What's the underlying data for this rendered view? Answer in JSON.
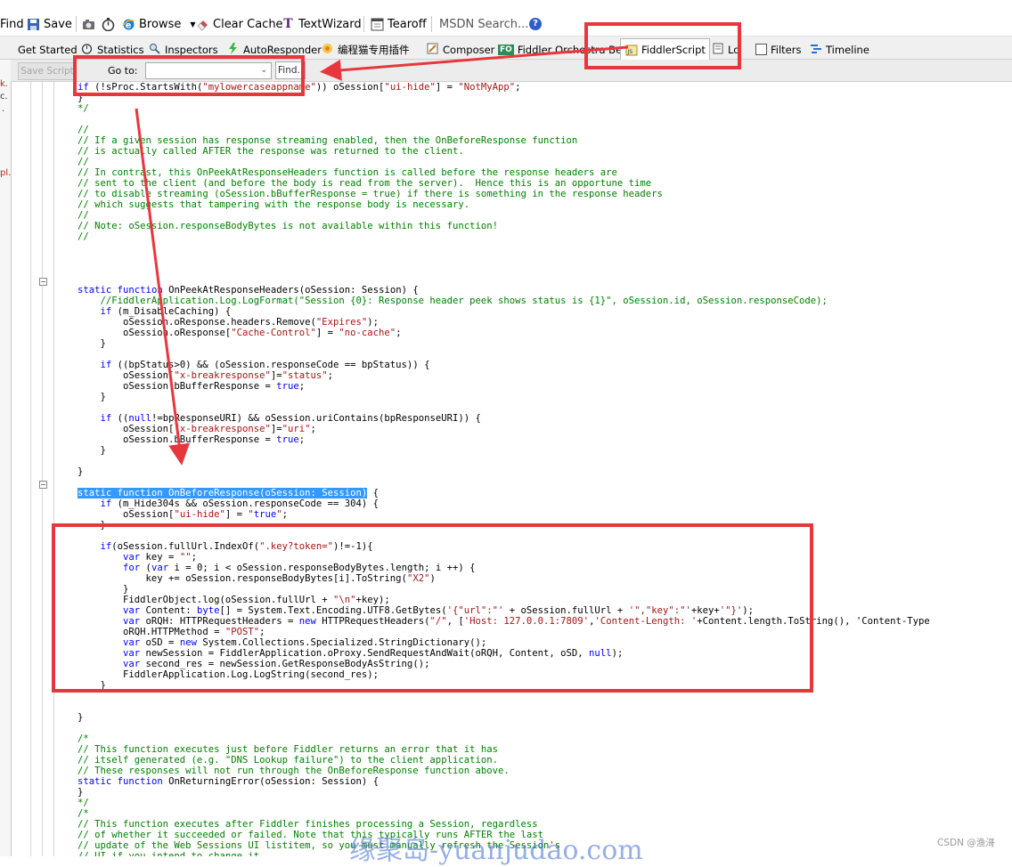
{
  "toolbar": {
    "find": "Find",
    "save": "Save",
    "browse": "Browse",
    "clear_cache": "Clear Cache",
    "textwizard": "TextWizard",
    "tearoff": "Tearoff",
    "search_placeholder": "MSDN Search...",
    "help": "?"
  },
  "tabs": [
    {
      "label": "Get Started"
    },
    {
      "label": "Statistics"
    },
    {
      "label": "Inspectors"
    },
    {
      "label": "AutoResponder"
    },
    {
      "label": "编程猫专用插件"
    },
    {
      "label": "Composer"
    },
    {
      "label": "Fiddler Orchestra Beta",
      "badge": "FO"
    },
    {
      "label": "FiddlerScript",
      "active": true
    },
    {
      "label": "Lo"
    },
    {
      "label": "Filters"
    },
    {
      "label": "Timeline"
    }
  ],
  "scriptbar": {
    "save_script": "Save Script",
    "goto_label": "Go to:",
    "find_placeholder": "Find..."
  },
  "left_panel_fragments": [
    "k.",
    "c.",
    ".",
    "pl."
  ],
  "code_lines": [
    "if (!sProc.StartsWith(\"mylowercaseappname\")) oSession[\"ui-hide\"] = \"NotMyApp\";",
    "}",
    "*/",
    "",
    "//",
    "// If a given session has response streaming enabled, then the OnBeforeResponse function",
    "// is actually called AFTER the response was returned to the client.",
    "//",
    "// In contrast, this OnPeekAtResponseHeaders function is called before the response headers are",
    "// sent to the client (and before the body is read from the server).  Hence this is an opportune time",
    "// to disable streaming (oSession.bBufferResponse = true) if there is something in the response headers",
    "// which suggests that tampering with the response body is necessary.",
    "//",
    "// Note: oSession.responseBodyBytes is not available within this function!",
    "//",
    "",
    "",
    "",
    "",
    "static function OnPeekAtResponseHeaders(oSession: Session) {",
    "    //FiddlerApplication.Log.LogFormat(\"Session {0}: Response header peek shows status is {1}\", oSession.id, oSession.responseCode);",
    "    if (m_DisableCaching) {",
    "        oSession.oResponse.headers.Remove(\"Expires\");",
    "        oSession.oResponse[\"Cache-Control\"] = \"no-cache\";",
    "    }",
    "",
    "    if ((bpStatus>0) && (oSession.responseCode == bpStatus)) {",
    "        oSession[\"x-breakresponse\"]=\"status\";",
    "        oSession.bBufferResponse = true;",
    "    }",
    "",
    "    if ((null!=bpResponseURI) && oSession.uriContains(bpResponseURI)) {",
    "        oSession[\"x-breakresponse\"]=\"uri\";",
    "        oSession.bBufferResponse = true;",
    "    }",
    "",
    "}",
    "",
    "static function OnBeforeResponse(oSession: Session) {",
    "    if (m_Hide304s && oSession.responseCode == 304) {",
    "        oSession[\"ui-hide\"] = \"true\";",
    "    }",
    "",
    "    if(oSession.fullUrl.IndexOf(\".key?token=\")!=-1){",
    "        var key = \"\";",
    "        for (var i = 0; i < oSession.responseBodyBytes.length; i ++) {",
    "            key += oSession.responseBodyBytes[i].ToString(\"X2\")",
    "        }",
    "        FiddlerObject.log(oSession.fullUrl + \"\\n\"+key);",
    "        var Content: byte[] = System.Text.Encoding.UTF8.GetBytes('{\"url\":\"' + oSession.fullUrl + '\",\"key\":\"'+key+'\"}');",
    "        var oRQH: HTTPRequestHeaders = new HTTPRequestHeaders(\"/\", ['Host: 127.0.0.1:7809','Content-Length: '+Content.length.ToString(), 'Content-Type",
    "        oRQH.HTTPMethod = \"POST\";",
    "        var oSD = new System.Collections.Specialized.StringDictionary();",
    "        var newSession = FiddlerApplication.oProxy.SendRequestAndWait(oRQH, Content, oSD, null);",
    "        var second_res = newSession.GetResponseBodyAsString();",
    "        FiddlerApplication.Log.LogString(second_res);",
    "    }",
    "",
    "",
    "}",
    "",
    "/*",
    "// This function executes just before Fiddler returns an error that it has",
    "// itself generated (e.g. \"DNS Lookup failure\") to the client application.",
    "// These responses will not run through the OnBeforeResponse function above.",
    "static function OnReturningError(oSession: Session) {",
    "}",
    "*/",
    "/*",
    "// This function executes after Fiddler finishes processing a Session, regardless",
    "// of whether it succeeded or failed. Note that this typically runs AFTER the last",
    "// update of the Web Sessions UI listitem, so you must manually refresh the Session's",
    "// UI if you intend to change it."
  ],
  "watermark": "缘聚岛-yuanjudao.com",
  "csdn_tag": "CSDN @渔滒",
  "colors": {
    "annotation_red": "#e8363d",
    "keyword_blue": "#0000ff",
    "string_red": "#a31515",
    "selection": "#3399ff"
  }
}
